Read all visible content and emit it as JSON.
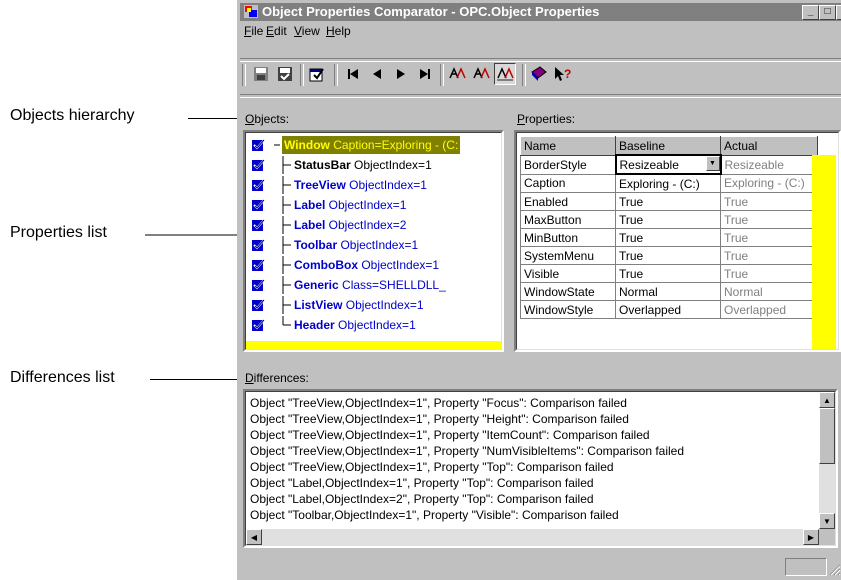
{
  "callouts": {
    "objects_hierarchy": "Objects hierarchy",
    "properties_list": "Properties list",
    "differences_list": "Differences list"
  },
  "window": {
    "title": "Object Properties Comparator - OPC.Object Properties",
    "minimize": "_",
    "maximize": "□",
    "close": "×"
  },
  "menu": [
    {
      "prefix": "",
      "underline": "F",
      "rest": "ile"
    },
    {
      "prefix": "",
      "underline": "E",
      "rest": "dit"
    },
    {
      "prefix": "",
      "underline": "V",
      "rest": "iew"
    },
    {
      "prefix": "",
      "underline": "H",
      "rest": "elp"
    }
  ],
  "toolbar": {
    "icons": [
      "save-icon",
      "save-checked-icon",
      "properties-icon",
      "first-icon",
      "previous-icon",
      "next-icon",
      "last-icon",
      "compare-icon",
      "compare-selected-icon",
      "compare-all-icon",
      "book-icon",
      "context-help-icon"
    ]
  },
  "objects_panel": {
    "label_underline": "O",
    "label_rest": "bjects:",
    "items": [
      {
        "name": "Window",
        "detail": " Caption=Exploring - (C:",
        "selected": true
      },
      {
        "name": "StatusBar",
        "detail": " ObjectIndex=1",
        "color": "black"
      },
      {
        "name": "TreeView",
        "detail": " ObjectIndex=1",
        "color": "blue"
      },
      {
        "name": "Label",
        "detail": " ObjectIndex=1",
        "color": "blue"
      },
      {
        "name": "Label",
        "detail": " ObjectIndex=2",
        "color": "blue"
      },
      {
        "name": "Toolbar",
        "detail": " ObjectIndex=1",
        "color": "blue"
      },
      {
        "name": "ComboBox",
        "detail": " ObjectIndex=1",
        "color": "blue"
      },
      {
        "name": "Generic",
        "detail": " Class=SHELLDLL_",
        "color": "blue"
      },
      {
        "name": "ListView",
        "detail": " ObjectIndex=1",
        "color": "blue"
      },
      {
        "name": "Header",
        "detail": " ObjectIndex=1",
        "color": "blue"
      }
    ]
  },
  "properties_panel": {
    "label_underline": "P",
    "label_rest": "roperties:",
    "columns": [
      "Name",
      "Baseline",
      "Actual"
    ],
    "rows": [
      [
        "BorderStyle",
        "Resizeable",
        "Resizeable"
      ],
      [
        "Caption",
        "Exploring - (C:)",
        "Exploring - (C:)"
      ],
      [
        "Enabled",
        "True",
        "True"
      ],
      [
        "MaxButton",
        "True",
        "True"
      ],
      [
        "MinButton",
        "True",
        "True"
      ],
      [
        "SystemMenu",
        "True",
        "True"
      ],
      [
        "Visible",
        "True",
        "True"
      ],
      [
        "WindowState",
        "Normal",
        "Normal"
      ],
      [
        "WindowStyle",
        "Overlapped",
        "Overlapped"
      ]
    ]
  },
  "differences_panel": {
    "label_underline": "D",
    "label_rest": "ifferences:",
    "lines": [
      "Object \"TreeView,ObjectIndex=1\", Property \"Focus\": Comparison failed",
      "Object \"TreeView,ObjectIndex=1\", Property \"Height\": Comparison failed",
      "Object \"TreeView,ObjectIndex=1\", Property \"ItemCount\": Comparison failed",
      "Object \"TreeView,ObjectIndex=1\", Property \"NumVisibleItems\": Comparison failed",
      "Object \"TreeView,ObjectIndex=1\", Property \"Top\": Comparison failed",
      "Object \"Label,ObjectIndex=1\", Property \"Top\": Comparison failed",
      "Object \"Label,ObjectIndex=2\", Property \"Top\": Comparison failed",
      "Object \"Toolbar,ObjectIndex=1\", Property \"Visible\": Comparison failed"
    ]
  },
  "colors": {
    "title_bar": "#808080",
    "selected_node_bg": "#808000",
    "highlight_strip": "#ffff00",
    "object_text_blue": "#0000c8",
    "actual_text_gray": "#808080"
  }
}
